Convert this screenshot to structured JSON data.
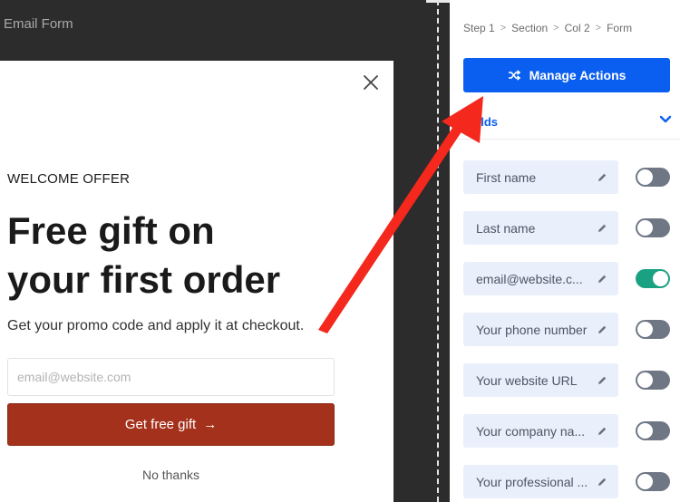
{
  "canvas": {
    "title": "Email Form"
  },
  "popup": {
    "eyebrow": "WELCOME OFFER",
    "headline_line1": "Free gift on",
    "headline_line2": "your first order",
    "subtext": "Get your promo code and apply it at checkout.",
    "email_placeholder": "email@website.com",
    "cta_label": "Get free gift",
    "cta_arrow": "→",
    "no_thanks": "No thanks",
    "cta_color": "#a4311c"
  },
  "panel": {
    "breadcrumb": [
      "Step 1",
      "Section",
      "Col 2",
      "Form"
    ],
    "breadcrumb_sep": ">",
    "manage_actions": "Manage Actions",
    "section_label": "elds",
    "accent_color": "#0b5ff0",
    "fields": [
      {
        "label": "First name",
        "enabled": false
      },
      {
        "label": "Last name",
        "enabled": false
      },
      {
        "label": "email@website.c...",
        "enabled": true
      },
      {
        "label": "Your phone number",
        "enabled": false
      },
      {
        "label": "Your website URL",
        "enabled": false
      },
      {
        "label": "Your company na...",
        "enabled": false
      },
      {
        "label": "Your professional ...",
        "enabled": false
      }
    ]
  },
  "annotation": {
    "color": "#f4281c",
    "icon": "red-arrow-pointing-to-manage-actions"
  }
}
